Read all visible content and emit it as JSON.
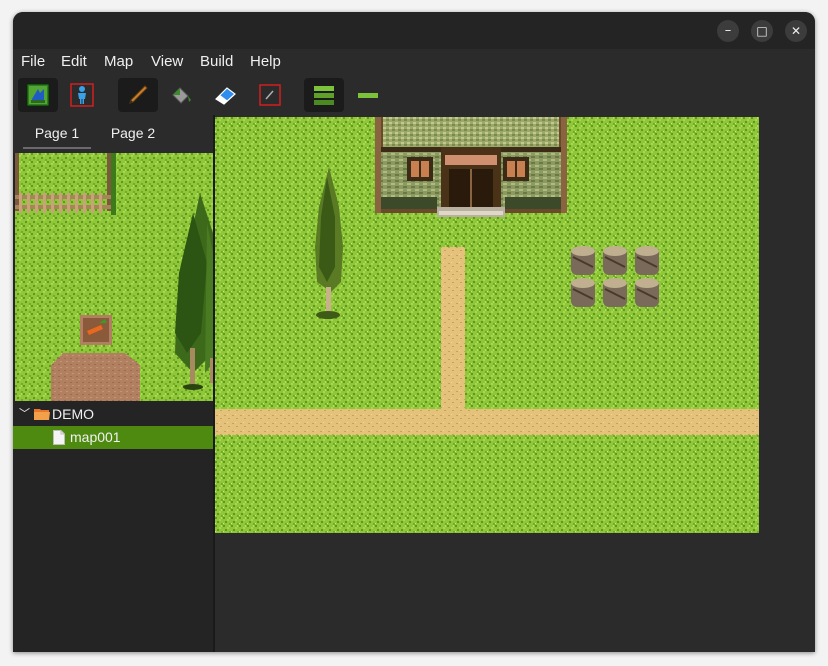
{
  "window": {
    "controls": {
      "minimize": "–",
      "maximize": "□",
      "close": "✕"
    }
  },
  "menu": {
    "items": [
      "File",
      "Edit",
      "Map",
      "View",
      "Build",
      "Help"
    ]
  },
  "toolbar": {
    "tools": [
      {
        "name": "layer-ground-icon",
        "active": true
      },
      {
        "name": "layer-event-icon",
        "active": false
      },
      {
        "name": "pencil-icon",
        "active": true
      },
      {
        "name": "fill-bucket-icon",
        "active": false
      },
      {
        "name": "eraser-icon",
        "active": false
      },
      {
        "name": "rectangle-tool-icon",
        "active": false
      },
      {
        "name": "layers-stack-icon",
        "active": true
      },
      {
        "name": "single-layer-icon",
        "active": false
      }
    ]
  },
  "tabs": [
    "Page 1",
    "Page 2"
  ],
  "active_tab": "Page 1",
  "tree": {
    "project": "DEMO",
    "maps": [
      "map001"
    ],
    "selected": "map001"
  },
  "colors": {
    "grass": "#8fc63a",
    "grass_dark": "#5e9a1e",
    "path": "#e4c27c",
    "selection": "#4e8a10",
    "panel_bg": "#242424"
  }
}
